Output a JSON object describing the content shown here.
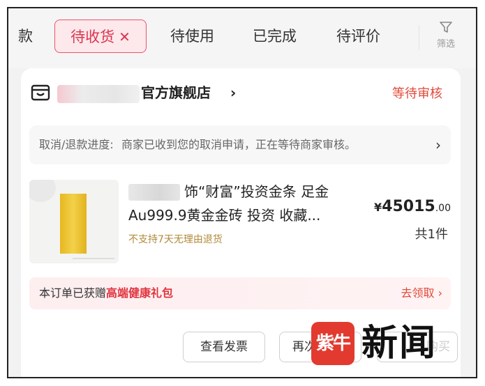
{
  "tabs": {
    "partial": "款",
    "active": "待收货",
    "active_close": "✕",
    "t3": "待使用",
    "t4": "已完成",
    "t5": "待评价",
    "filter": "筛选"
  },
  "order": {
    "store_name": "官方旗舰店",
    "store_chevron": "›",
    "status": "等待审核",
    "progress_label": "取消/退款进度:",
    "progress_text": "商家已收到您的取消申请，正在等待商家审核。",
    "progress_chevron": "›",
    "product": {
      "title_line1": "饰“财富”投资金条 足金",
      "title_line2": "Au999.9黄金金砖 投资 收藏...",
      "note": "不支持7天无理由退货",
      "price_currency": "¥",
      "price_int": "45015",
      "price_dec": ".00",
      "quantity": "共1件"
    },
    "gift": {
      "prefix": "本订单已获赠",
      "highlight": "高端健康礼包",
      "action": "去领取 ›"
    },
    "buttons": {
      "invoice": "查看发票",
      "second": "再次",
      "third": "购买"
    }
  },
  "watermark": {
    "badge": "紫牛",
    "text": "新闻"
  },
  "colors": {
    "accent_red": "#e04a3a",
    "tab_active_bg": "#fde8ec",
    "gold": "#f3d14a"
  }
}
